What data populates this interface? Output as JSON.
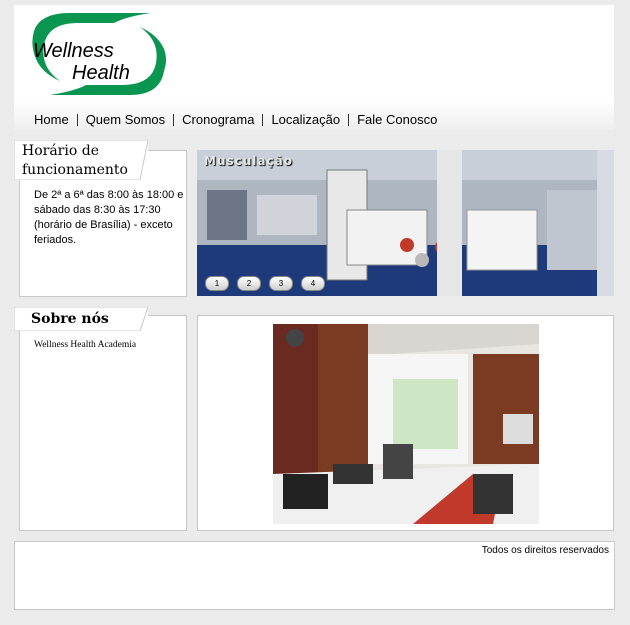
{
  "brand": {
    "line1": "Wellness",
    "line2": "Health",
    "accent": "#0a9650"
  },
  "nav": {
    "items": [
      "Home",
      "Quem Somos",
      "Cronograma",
      "Localização",
      "Fale Conosco"
    ]
  },
  "hours": {
    "title_line1": "Horário de",
    "title_line2": "funcionamento",
    "text": "De 2ª a 6ª das 8:00 às 18:00 e sábado das 8:30 às 17:30 (horário de Brasília) - exceto feriados."
  },
  "slider": {
    "title": "Musculação",
    "pages": [
      "1",
      "2",
      "3",
      "4"
    ]
  },
  "about": {
    "title": "Sobre nós",
    "text": "Wellness Health Academia"
  },
  "footer": {
    "text": "Todos os direitos reservados"
  }
}
